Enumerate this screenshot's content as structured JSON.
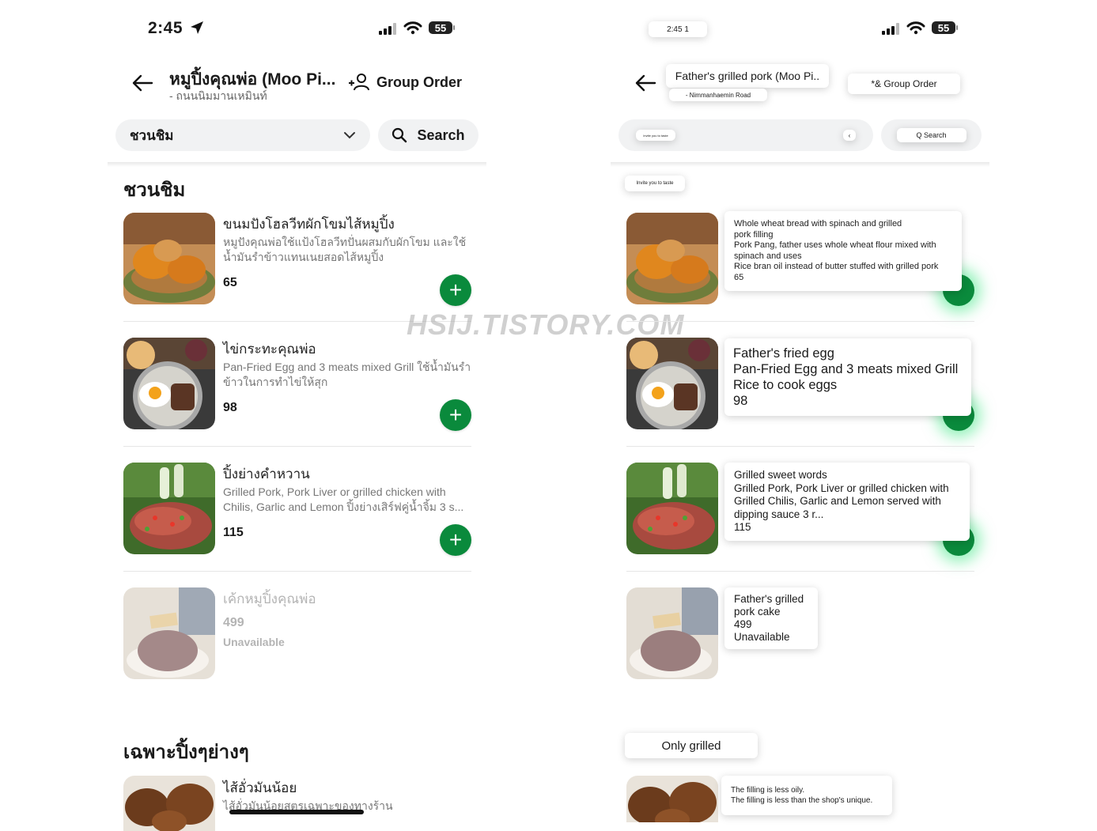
{
  "left": {
    "status": {
      "time": "2:45",
      "battery": "55"
    },
    "header": {
      "back_icon": "arrow-left-icon",
      "title": "หมูปิ้งคุณพ่อ (Moo Pi...",
      "subtitle": "- ถนนนิมมานเหมินท์",
      "group_order": "Group Order",
      "group_icon": "add-group-icon"
    },
    "category_select": {
      "value": "ชวนชิม"
    },
    "search": {
      "label": "Search"
    },
    "sections": [
      {
        "title": "ชวนชิม"
      },
      {
        "title": "เฉพาะปิ้งๆย่างๆ"
      }
    ],
    "items": [
      {
        "name": "ขนมปังโฮลวีทผักโขมไส้หมูปิ้ง",
        "desc": "หมูปังคุณพ่อใช้แป้งโฮลวีทปั่นผสมกับผักโขม และใช้น้ำมันรำข้าวแทนเนยสอดไส้หมูปิ้ง",
        "price": "65"
      },
      {
        "name": "ไข่กระทะคุณพ่อ",
        "desc": "Pan-Fried Egg and 3 meats mixed Grill ใช้น้ำมันรำข้าวในการทำไข่ให้สุก",
        "price": "98"
      },
      {
        "name": "ปิ้งย่างคำหวาน",
        "desc": "Grilled Pork, Pork Liver or grilled chicken with Chilis, Garlic and Lemon ปิ้งย่างเสิร์ฟคู่น้ำจิ้ม 3 s...",
        "price": "115"
      },
      {
        "name": "เค้กหมูปิ้งคุณพ่อ",
        "price": "499",
        "status": "Unavailable"
      },
      {
        "name": "ไส้อั่วมันน้อย",
        "desc": "ไส้อั่วมันน้อยสูตรเฉพาะของทางร้าน"
      }
    ],
    "add_label": "+"
  },
  "watermark": "HSIJ.TISTORY.COM",
  "right": {
    "status": {
      "time": "2:45 1",
      "battery": "55"
    },
    "header": {
      "title": "Father's grilled pork (Moo Pi..",
      "subtitle": "- Nimmanhaemin Road",
      "group_order": "*& Group Order"
    },
    "category_select": {
      "value": "Invite you to taste",
      "chevron": "‹"
    },
    "search": {
      "label": "Q Search"
    },
    "section_chip": "Invite you to taste",
    "cards": [
      {
        "lines": [
          "Whole wheat bread with spinach and grilled",
          "pork filling",
          "Pork Pang, father uses whole wheat flour mixed with",
          "spinach and uses",
          "Rice bran oil instead of butter stuffed with grilled pork",
          "65"
        ]
      },
      {
        "lines": [
          "Father's fried egg",
          "Pan-Fried Egg and 3 meats mixed Grill",
          "Rice to cook eggs",
          "98"
        ]
      },
      {
        "lines": [
          "Grilled sweet words",
          "Grilled Pork, Pork Liver or grilled chicken with",
          "Grilled Chilis, Garlic and Lemon served with",
          "dipping sauce 3 r...",
          "115"
        ]
      },
      {
        "lines": [
          "Father's grilled",
          "pork cake",
          "499",
          "Unavailable"
        ]
      }
    ],
    "section2_chip": "Only grilled",
    "last_card": {
      "lines": [
        "The filling is less oily.",
        "The filling is less than the shop's unique."
      ]
    }
  }
}
